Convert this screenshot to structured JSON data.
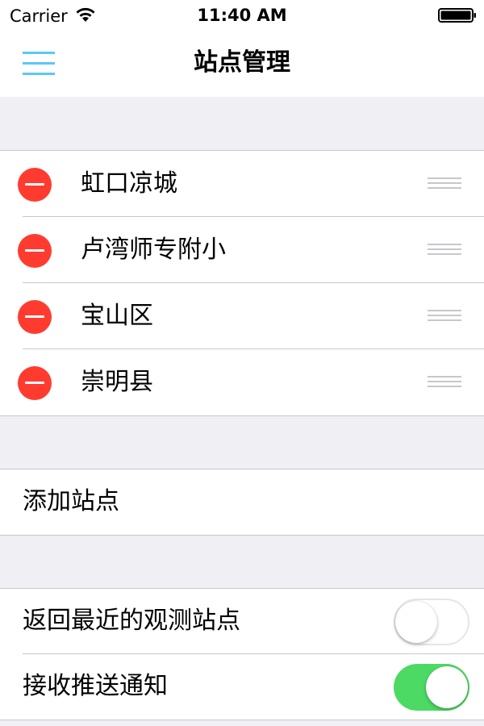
{
  "status_bar": {
    "carrier": "Carrier",
    "time": "11:40 AM"
  },
  "nav": {
    "title": "站点管理",
    "menu_icon": "hamburger-menu-icon",
    "accent_color": "#5ac8fa"
  },
  "stations": [
    {
      "name": "虹口凉城"
    },
    {
      "name": "卢湾师专附小"
    },
    {
      "name": "宝山区"
    },
    {
      "name": "崇明县"
    }
  ],
  "add_station": {
    "label": "添加站点"
  },
  "settings": [
    {
      "label": "返回最近的观测站点",
      "enabled": false
    },
    {
      "label": "接收推送通知",
      "enabled": true
    }
  ],
  "colors": {
    "delete": "#ff3b30",
    "toggle_on": "#4cd964",
    "background": "#efeff4"
  }
}
